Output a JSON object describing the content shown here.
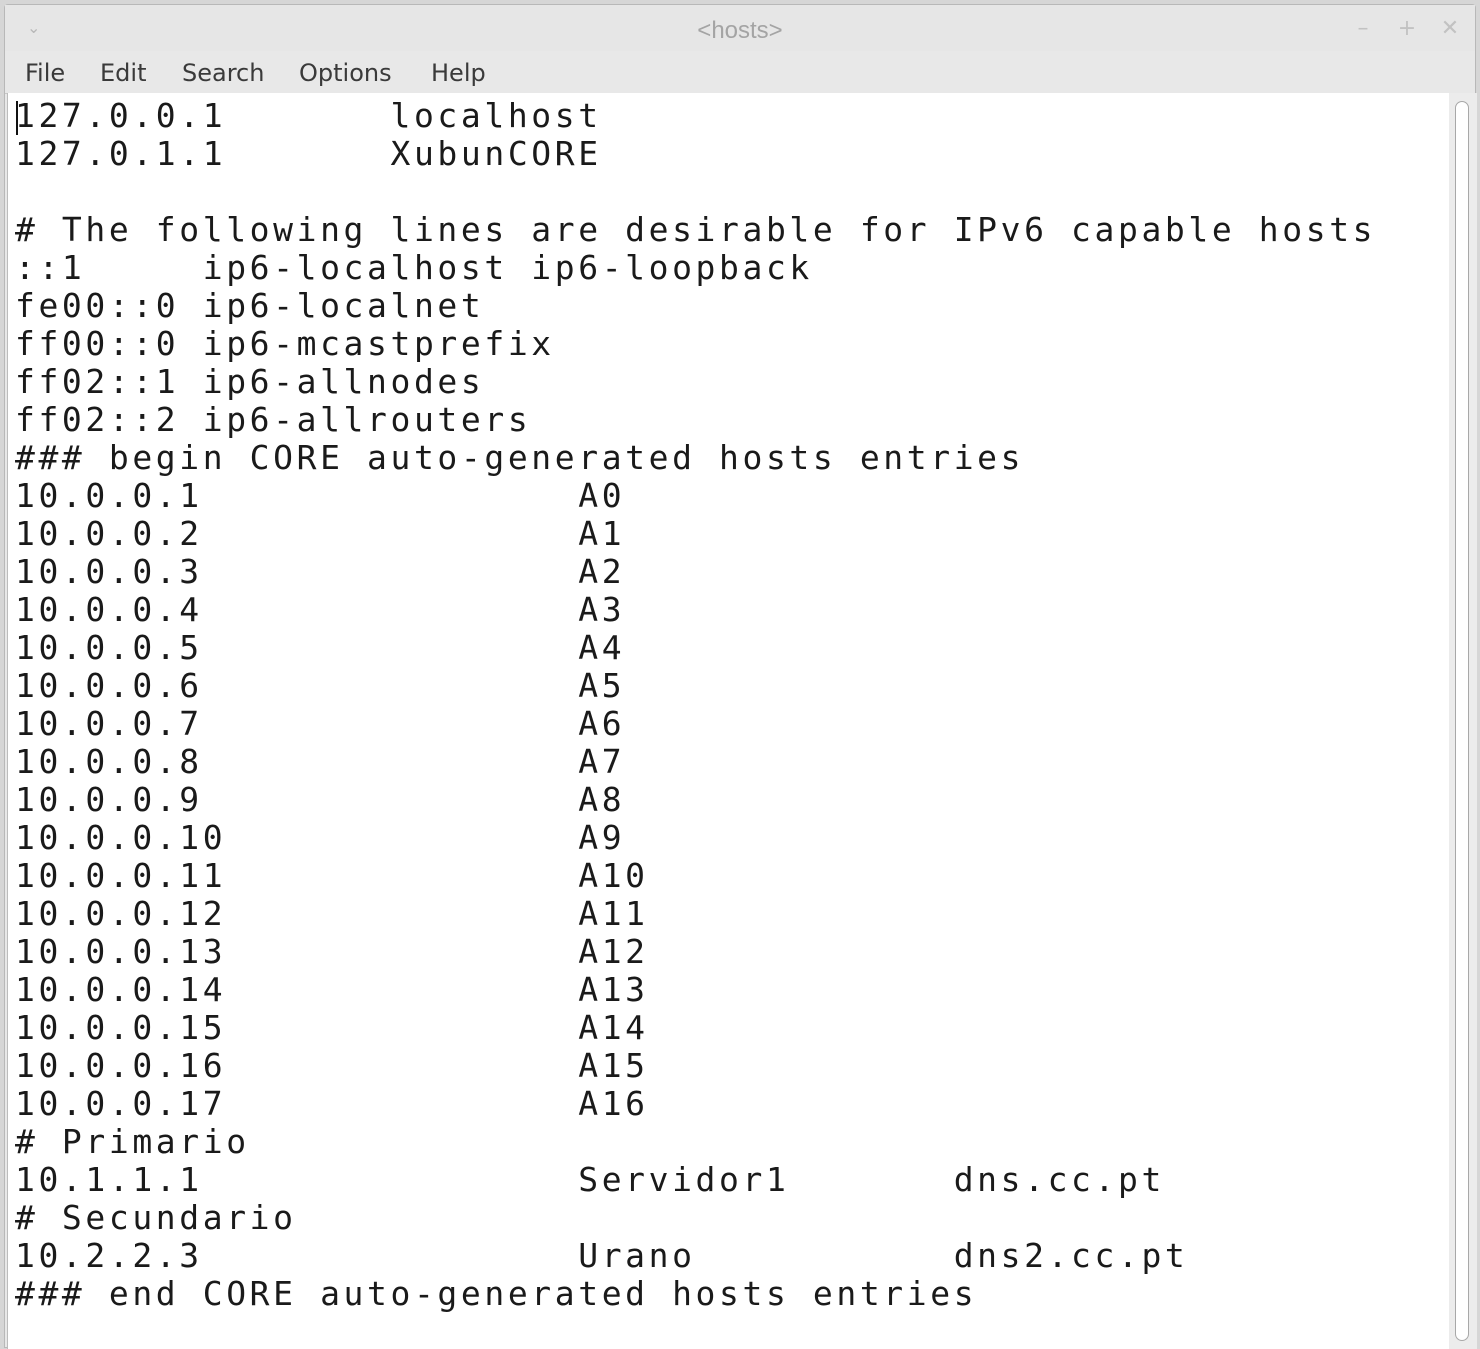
{
  "window": {
    "title": "<hosts>",
    "controls": {
      "menu_icon": "chevron-down-icon",
      "minimize": "–",
      "maximize": "+",
      "close": "✕"
    }
  },
  "menubar": {
    "items": [
      "File",
      "Edit",
      "Search",
      "Options",
      "Help"
    ]
  },
  "editor": {
    "lines": [
      "127.0.0.1       localhost",
      "127.0.1.1       XubunCORE",
      "",
      "# The following lines are desirable for IPv6 capable hosts",
      "::1     ip6-localhost ip6-loopback",
      "fe00::0 ip6-localnet",
      "ff00::0 ip6-mcastprefix",
      "ff02::1 ip6-allnodes",
      "ff02::2 ip6-allrouters",
      "### begin CORE auto-generated hosts entries",
      "10.0.0.1                A0",
      "10.0.0.2                A1",
      "10.0.0.3                A2",
      "10.0.0.4                A3",
      "10.0.0.5                A4",
      "10.0.0.6                A5",
      "10.0.0.7                A6",
      "10.0.0.8                A7",
      "10.0.0.9                A8",
      "10.0.0.10               A9",
      "10.0.0.11               A10",
      "10.0.0.12               A11",
      "10.0.0.13               A12",
      "10.0.0.14               A13",
      "10.0.0.15               A14",
      "10.0.0.16               A15",
      "10.0.0.17               A16",
      "# Primario",
      "10.1.1.1                Servidor1       dns.cc.pt",
      "# Secundario",
      "10.2.2.3                Urano           dns2.cc.pt",
      "### end CORE auto-generated hosts entries"
    ]
  }
}
